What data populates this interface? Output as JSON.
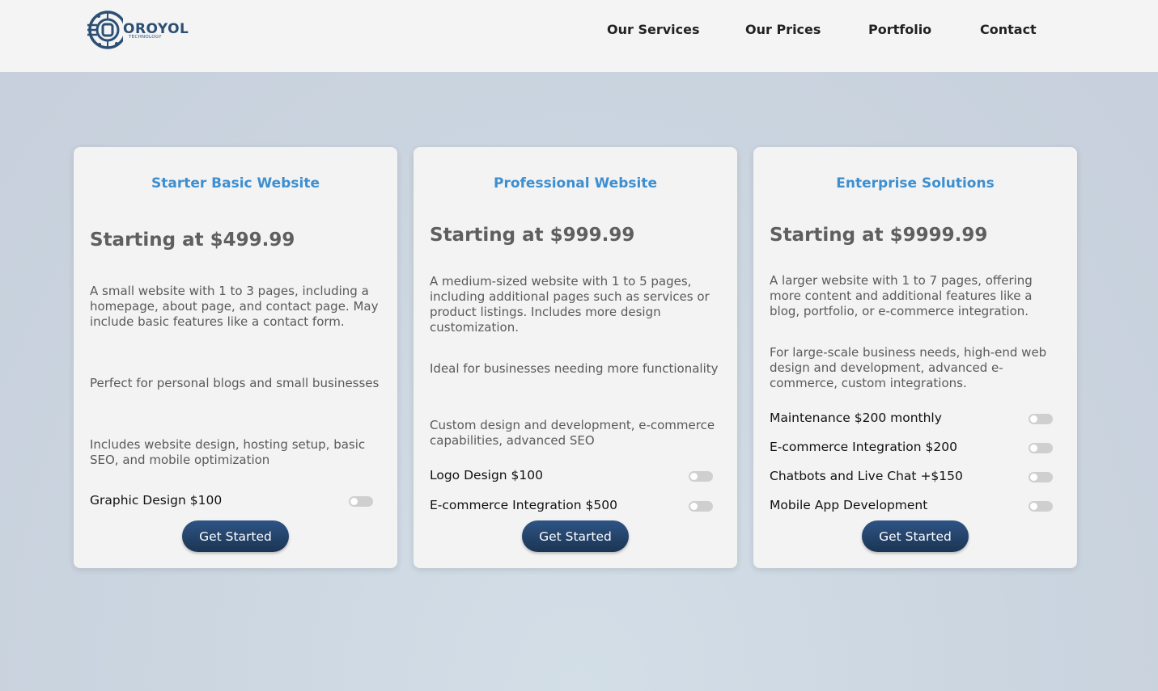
{
  "brand": {
    "logo_text": "OROYOL",
    "logo_subtext": "TECHNOLOGY",
    "accent_color": "#2c4f74"
  },
  "nav": {
    "items": [
      "Our Services",
      "Our Prices",
      "Portfolio",
      "Contact"
    ]
  },
  "cards": [
    {
      "title": "Starter Basic Website",
      "price": "Starting at $499.99",
      "descriptions": [
        "A small website with 1 to 3 pages, including a homepage, about page, and contact page. May include basic features like a contact form.",
        "Perfect for personal blogs and small businesses",
        "Includes website design, hosting setup, basic SEO, and mobile optimization"
      ],
      "addons": [
        {
          "label": "Graphic Design $100",
          "enabled": false
        }
      ],
      "button_label": "Get Started"
    },
    {
      "title": "Professional Website",
      "price": "Starting at $999.99",
      "descriptions": [
        "A medium-sized website with 1 to 5 pages, including additional pages such as services or product listings. Includes more design customization.",
        "Ideal for businesses needing more functionality",
        "Custom design and development, e-commerce capabilities, advanced SEO"
      ],
      "addons": [
        {
          "label": "Logo Design $100",
          "enabled": false
        },
        {
          "label": "E-commerce Integration $500",
          "enabled": false
        }
      ],
      "button_label": "Get Started"
    },
    {
      "title": "Enterprise Solutions",
      "price": "Starting at $9999.99",
      "descriptions": [
        "A larger website with 1 to 7 pages, offering more content and additional features like a blog, portfolio, or e-commerce integration.",
        "For large-scale business needs, high-end web design and development, advanced e-commerce, custom integrations."
      ],
      "addons": [
        {
          "label": "Maintenance $200 monthly",
          "enabled": false
        },
        {
          "label": "E-commerce Integration $200",
          "enabled": false
        },
        {
          "label": "Chatbots and Live Chat +$150",
          "enabled": false
        },
        {
          "label": "Mobile App Development",
          "enabled": false
        }
      ],
      "button_label": "Get Started"
    }
  ],
  "colors": {
    "card_title": "#3d8fd0",
    "button": "#1f3d63"
  }
}
